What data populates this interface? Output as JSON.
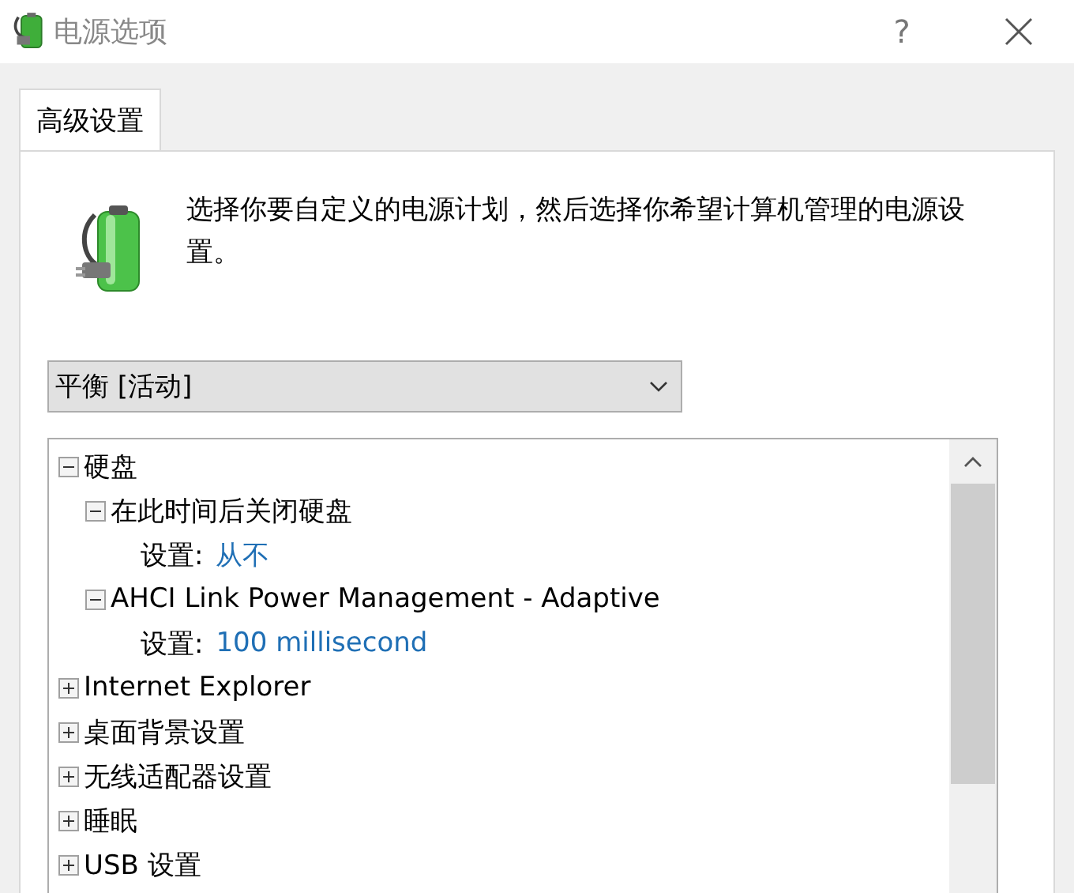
{
  "window": {
    "title": "电源选项",
    "help": "?"
  },
  "tabs": [
    {
      "label": "高级设置",
      "selected": true
    }
  ],
  "description": "选择你要自定义的电源计划，然后选择你希望计算机管理的电源设置。",
  "plan_dropdown": {
    "value": "平衡 [活动]"
  },
  "tree": [
    {
      "kind": "group",
      "label": "硬盘",
      "expanded": true,
      "children": [
        {
          "kind": "group",
          "label": "在此时间后关闭硬盘",
          "expanded": true,
          "children": [
            {
              "kind": "setting",
              "label": "设置:",
              "value": "从不"
            }
          ]
        },
        {
          "kind": "group",
          "label": "AHCI Link Power Management - Adaptive",
          "expanded": true,
          "children": [
            {
              "kind": "setting",
              "label": "设置:",
              "value": "100 millisecond"
            }
          ]
        }
      ]
    },
    {
      "kind": "group",
      "label": "Internet Explorer",
      "expanded": false
    },
    {
      "kind": "group",
      "label": "桌面背景设置",
      "expanded": false
    },
    {
      "kind": "group",
      "label": "无线适配器设置",
      "expanded": false
    },
    {
      "kind": "group",
      "label": "睡眠",
      "expanded": false
    },
    {
      "kind": "group",
      "label": "USB 设置",
      "expanded": false
    }
  ]
}
